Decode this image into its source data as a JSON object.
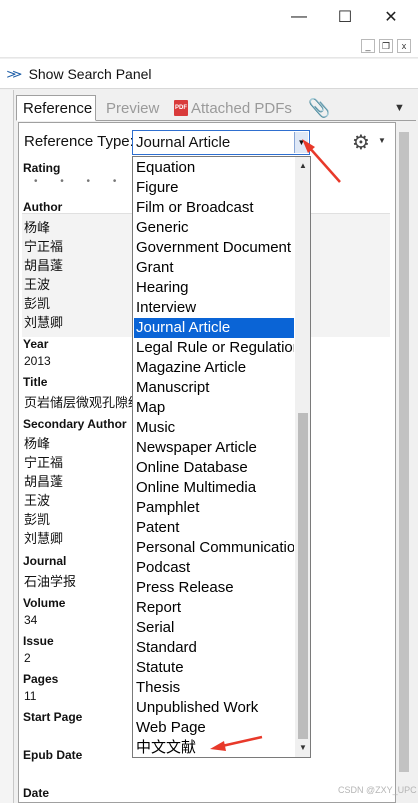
{
  "window": {
    "minimize_glyph": "—",
    "maximize_glyph": "☐",
    "close_glyph": "✕",
    "sub_minimize_glyph": "_",
    "sub_restore_glyph": "❐",
    "sub_close_glyph": "x"
  },
  "search_panel": {
    "chevron": "≫",
    "label": "Show Search Panel"
  },
  "tabs": {
    "reference": "Reference",
    "preview": "Preview",
    "pdf_icon_text": "PDF",
    "attached_pdfs": "Attached PDFs",
    "paperclip_glyph": "📎",
    "menu_glyph": "▼"
  },
  "reference_type": {
    "label": "Reference Type:",
    "value": "Journal Article",
    "drop_glyph": "▼",
    "gear_glyph": "⚙",
    "gear_caret": "▼"
  },
  "fields": {
    "rating_label": "Rating",
    "rating_dots": "• • • • •",
    "author_label": "Author",
    "authors": [
      "杨峰",
      "宁正福",
      "胡昌蓬",
      "王波",
      "彭凯",
      "刘慧卿"
    ],
    "year_label": "Year",
    "year_value": "2013",
    "title_label": "Title",
    "title_value": "页岩储层微观孔隙结",
    "secondary_author_label": "Secondary Author",
    "secondary_authors": [
      "杨峰",
      "宁正福",
      "胡昌蓬",
      "王波",
      "彭凯",
      "刘慧卿"
    ],
    "journal_label": "Journal",
    "journal_value": "石油学报",
    "volume_label": "Volume",
    "volume_value": "34",
    "issue_label": "Issue",
    "issue_value": "2",
    "pages_label": "Pages",
    "pages_value": "11",
    "start_page_label": "Start Page",
    "epub_date_label": "Epub Date",
    "date_label": "Date"
  },
  "dropdown": {
    "items": [
      "Equation",
      "Figure",
      "Film or Broadcast",
      "Generic",
      "Government Document",
      "Grant",
      "Hearing",
      "Interview",
      "Journal Article",
      "Legal Rule or Regulation",
      "Magazine Article",
      "Manuscript",
      "Map",
      "Music",
      "Newspaper Article",
      "Online Database",
      "Online Multimedia",
      "Pamphlet",
      "Patent",
      "Personal Communication",
      "Podcast",
      "Press Release",
      "Report",
      "Serial",
      "Standard",
      "Statute",
      "Thesis",
      "Unpublished Work",
      "Web Page",
      "中文文献"
    ],
    "selected": "Journal Article",
    "up_glyph": "▲",
    "down_glyph": "▼"
  },
  "colors": {
    "selection": "#0a64d6",
    "annotation_arrow": "#e8392a",
    "select_border": "#2f6fcf"
  },
  "watermark": "CSDN @ZXY_UPC"
}
